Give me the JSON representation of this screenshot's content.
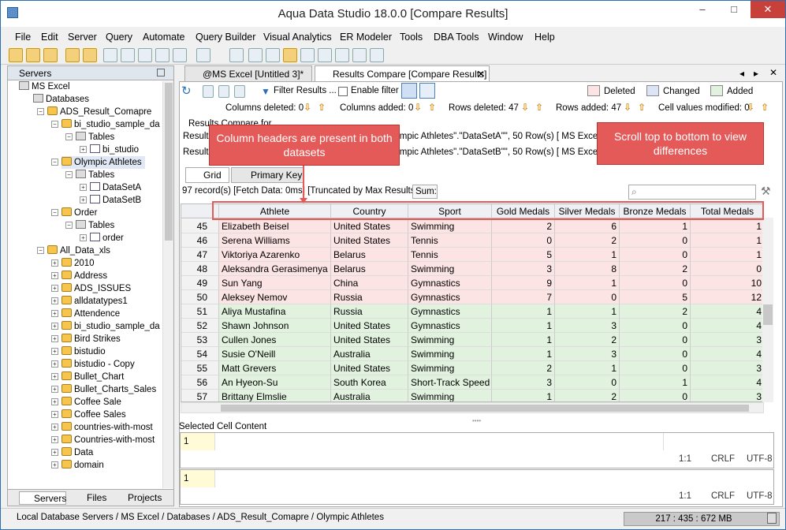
{
  "window": {
    "title": "Aqua Data Studio 18.0.0 [Compare Results]"
  },
  "menu": [
    "File",
    "Edit",
    "Server",
    "Query",
    "Automate",
    "Query Builder",
    "Visual Analytics",
    "ER Modeler",
    "Tools",
    "DBA Tools",
    "Window",
    "Help"
  ],
  "left_panel": {
    "header": "Servers",
    "tree": [
      {
        "label": "MS Excel",
        "depth": 0,
        "icon": "server-icon"
      },
      {
        "label": "Databases",
        "depth": 1,
        "icon": "folder-icon"
      },
      {
        "label": "ADS_Result_Comapre",
        "depth": 2,
        "icon": "database-icon"
      },
      {
        "label": "bi_studio_sample_da",
        "depth": 3,
        "icon": "database-icon"
      },
      {
        "label": "Tables",
        "depth": 4,
        "icon": "folder-icon"
      },
      {
        "label": "bi_studio",
        "depth": 5,
        "icon": "table-icon"
      },
      {
        "label": "Olympic Athletes",
        "depth": 3,
        "icon": "database-icon",
        "selected": true
      },
      {
        "label": "Tables",
        "depth": 4,
        "icon": "folder-icon"
      },
      {
        "label": "DataSetA",
        "depth": 5,
        "icon": "table-icon"
      },
      {
        "label": "DataSetB",
        "depth": 5,
        "icon": "table-icon"
      },
      {
        "label": "Order",
        "depth": 3,
        "icon": "database-icon"
      },
      {
        "label": "Tables",
        "depth": 4,
        "icon": "folder-icon"
      },
      {
        "label": "order",
        "depth": 5,
        "icon": "table-icon"
      },
      {
        "label": "All_Data_xls",
        "depth": 2,
        "icon": "database-icon"
      },
      {
        "label": "2010",
        "depth": 3,
        "icon": "database-icon"
      },
      {
        "label": "Address",
        "depth": 3,
        "icon": "database-icon"
      },
      {
        "label": "ADS_ISSUES",
        "depth": 3,
        "icon": "database-icon"
      },
      {
        "label": "alldatatypes1",
        "depth": 3,
        "icon": "database-icon"
      },
      {
        "label": "Attendence",
        "depth": 3,
        "icon": "database-icon"
      },
      {
        "label": "bi_studio_sample_da",
        "depth": 3,
        "icon": "database-icon"
      },
      {
        "label": "Bird Strikes",
        "depth": 3,
        "icon": "database-icon"
      },
      {
        "label": "bistudio",
        "depth": 3,
        "icon": "database-icon"
      },
      {
        "label": "bistudio - Copy",
        "depth": 3,
        "icon": "database-icon"
      },
      {
        "label": "Bullet_Chart",
        "depth": 3,
        "icon": "database-icon"
      },
      {
        "label": "Bullet_Charts_Sales",
        "depth": 3,
        "icon": "database-icon"
      },
      {
        "label": "Coffee Sale",
        "depth": 3,
        "icon": "database-icon"
      },
      {
        "label": "Coffee Sales",
        "depth": 3,
        "icon": "database-icon"
      },
      {
        "label": "countries-with-most",
        "depth": 3,
        "icon": "database-icon"
      },
      {
        "label": "Countries-with-most",
        "depth": 3,
        "icon": "database-icon"
      },
      {
        "label": "Data",
        "depth": 3,
        "icon": "database-icon"
      },
      {
        "label": "domain",
        "depth": 3,
        "icon": "database-icon"
      }
    ],
    "tabs": [
      "Servers",
      "Files",
      "Projects"
    ]
  },
  "doc_tabs": [
    "@MS Excel [Untitled 3]*",
    "Results Compare [Compare Results]"
  ],
  "compare_toolbar": {
    "filter_results": "Filter Results ...",
    "enable_filter": "Enable filter",
    "legend": {
      "deleted": "Deleted",
      "changed": "Changed",
      "added": "Added"
    },
    "colors": {
      "deleted": "#fde4e4",
      "changed": "#dce4f7",
      "added": "#e1f3df"
    },
    "columns_deleted": "Columns deleted: 0",
    "columns_added": "Columns added: 0",
    "rows_deleted": "Rows deleted: 47",
    "rows_added": "Rows added: 47",
    "cell_values_modified": "Cell values modified: 0"
  },
  "compare_for": {
    "label": "Results Compare for",
    "line1_prefix": "Result",
    "line1_text": "ympic Athletes\".\"DataSetA\"\", 50 Row(s)   [ MS Excel",
    "line2_prefix": "Result",
    "line2_text": "ympic Athletes\".\"DataSetB\"\", 50 Row(s)   [ MS Excel ]"
  },
  "result_tabs": [
    "Grid",
    "Primary Key"
  ],
  "info": {
    "records": "97 record(s) [Fetch Data: 0ms] [Truncated by Max Results]",
    "sum": "Sum:"
  },
  "grid": {
    "columns": [
      "Athlete",
      "Country",
      "Sport",
      "Gold Medals",
      "Silver Medals",
      "Bronze Medals",
      "Total Medals"
    ],
    "rows": [
      {
        "n": "45",
        "athlete": "Elizabeth Beisel",
        "country": "United States",
        "sport": "Swimming",
        "gold": "2",
        "silver": "6",
        "bronze": "1",
        "total": "1",
        "status": "deleted"
      },
      {
        "n": "46",
        "athlete": "Serena Williams",
        "country": "United States",
        "sport": "Tennis",
        "gold": "0",
        "silver": "2",
        "bronze": "0",
        "total": "1",
        "status": "deleted"
      },
      {
        "n": "47",
        "athlete": "Viktoriya Azarenko",
        "country": "Belarus",
        "sport": "Tennis",
        "gold": "5",
        "silver": "1",
        "bronze": "0",
        "total": "1",
        "status": "deleted"
      },
      {
        "n": "48",
        "athlete": "Aleksandra Gerasimenya",
        "country": "Belarus",
        "sport": "Swimming",
        "gold": "3",
        "silver": "8",
        "bronze": "2",
        "total": "0",
        "status": "deleted"
      },
      {
        "n": "49",
        "athlete": "Sun Yang",
        "country": "China",
        "sport": "Gymnastics",
        "gold": "9",
        "silver": "1",
        "bronze": "0",
        "total": "10",
        "status": "deleted"
      },
      {
        "n": "50",
        "athlete": "Aleksey Nemov",
        "country": "Russia",
        "sport": "Gymnastics",
        "gold": "7",
        "silver": "0",
        "bronze": "5",
        "total": "12",
        "status": "deleted"
      },
      {
        "n": "51",
        "athlete": "Aliya Mustafina",
        "country": "Russia",
        "sport": "Gymnastics",
        "gold": "1",
        "silver": "1",
        "bronze": "2",
        "total": "4",
        "status": "added"
      },
      {
        "n": "52",
        "athlete": "Shawn Johnson",
        "country": "United States",
        "sport": "Gymnastics",
        "gold": "1",
        "silver": "3",
        "bronze": "0",
        "total": "4",
        "status": "added"
      },
      {
        "n": "53",
        "athlete": "Cullen Jones",
        "country": "United States",
        "sport": "Swimming",
        "gold": "1",
        "silver": "2",
        "bronze": "0",
        "total": "3",
        "status": "added"
      },
      {
        "n": "54",
        "athlete": "Susie O'Neill",
        "country": "Australia",
        "sport": "Swimming",
        "gold": "1",
        "silver": "3",
        "bronze": "0",
        "total": "4",
        "status": "added"
      },
      {
        "n": "55",
        "athlete": "Matt Grevers",
        "country": "United States",
        "sport": "Swimming",
        "gold": "2",
        "silver": "1",
        "bronze": "0",
        "total": "3",
        "status": "added"
      },
      {
        "n": "56",
        "athlete": "An Hyeon-Su",
        "country": "South Korea",
        "sport": "Short-Track Speed",
        "gold": "3",
        "silver": "0",
        "bronze": "1",
        "total": "4",
        "status": "added"
      },
      {
        "n": "57",
        "athlete": "Brittany Elmslie",
        "country": "Australia",
        "sport": "Swimming",
        "gold": "1",
        "silver": "2",
        "bronze": "0",
        "total": "3",
        "status": "added"
      }
    ]
  },
  "callouts": {
    "headers": "Column headers are present in both datasets",
    "scroll": "Scroll top to bottom to view differences"
  },
  "selected_cell": {
    "label": "Selected Cell Content",
    "line": "1",
    "position": "1:1",
    "line_ending": "CRLF",
    "encoding": "UTF-8"
  },
  "bottom_editor": {
    "line": "1",
    "position": "1:1",
    "line_ending": "CRLF",
    "encoding": "UTF-8"
  },
  "status": {
    "path": "Local Database Servers / MS Excel / Databases / ADS_Result_Comapre / Olympic Athletes",
    "memory": "217 : 435 : 672 MB"
  }
}
